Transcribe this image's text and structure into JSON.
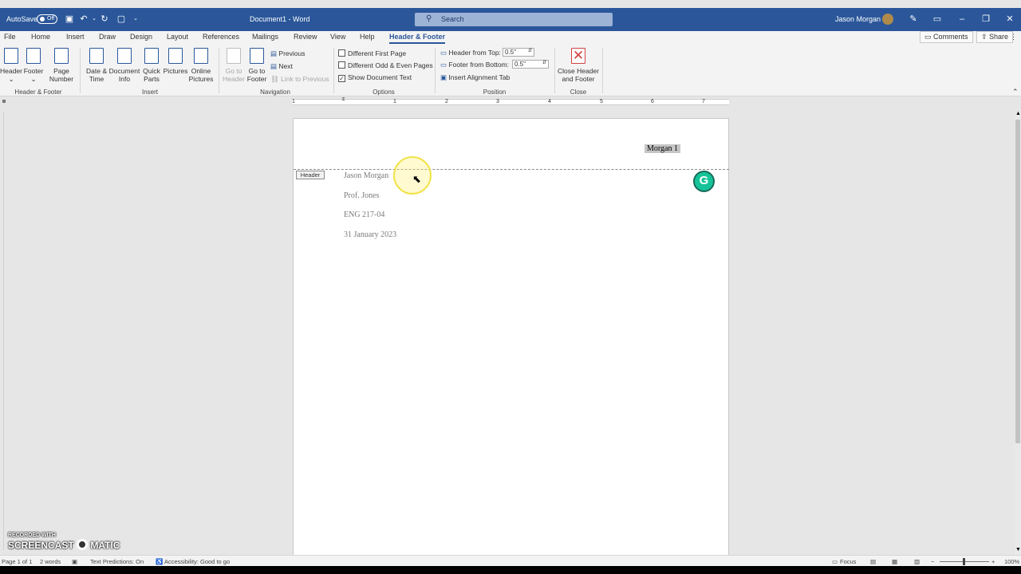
{
  "titlebar": {
    "autosave": "AutoSave",
    "autosave_state": "Off",
    "doc_title": "Document1 - Word",
    "search_placeholder": "Search",
    "user": "Jason Morgan"
  },
  "menu": [
    "File",
    "Home",
    "Insert",
    "Draw",
    "Design",
    "Layout",
    "References",
    "Mailings",
    "Review",
    "View",
    "Help",
    "Header & Footer"
  ],
  "menu_actions": {
    "comments": "Comments",
    "share": "Share"
  },
  "ribbon": {
    "header_footer": {
      "header": "Header",
      "footer": "Footer",
      "page": "Page",
      "number": "Number",
      "group": "Header & Footer"
    },
    "insert": {
      "date": "Date &",
      "time": "Time",
      "document": "Document",
      "info": "Info",
      "quick": "Quick",
      "parts": "Parts",
      "pictures": "Pictures",
      "online": "Online",
      "online2": "Pictures",
      "group": "Insert"
    },
    "navigation": {
      "goto_header1": "Go to",
      "goto_header2": "Header",
      "goto_footer1": "Go to",
      "goto_footer2": "Footer",
      "previous": "Previous",
      "next": "Next",
      "link": "Link to Previous",
      "group": "Navigation"
    },
    "options": {
      "diff_first": "Different First Page",
      "diff_odd": "Different Odd & Even Pages",
      "show_doc": "Show Document Text",
      "group": "Options"
    },
    "position": {
      "header_top": "Header from Top:",
      "header_top_val": "0.5\"",
      "footer_bottom": "Footer from Bottom:",
      "footer_bottom_val": "0.5\"",
      "align_tab": "Insert Alignment Tab",
      "group": "Position"
    },
    "close": {
      "label1": "Close Header",
      "label2": "and Footer",
      "group": "Close"
    }
  },
  "ruler": {
    "numbers": [
      "1",
      "1",
      "2",
      "3",
      "4",
      "5",
      "6",
      "7"
    ]
  },
  "document": {
    "header_tag": "Header",
    "header_text": "Morgan 1",
    "lines": [
      "Jason Morgan",
      "Prof. Jones",
      "ENG 217-04",
      "31 January 2023"
    ]
  },
  "grammarly": "G",
  "watermark": {
    "line1": "RECORDED WITH",
    "line2": "SCREENCAST",
    "line3": "MATIC"
  },
  "statusbar": {
    "page": "Page 1 of 1",
    "words": "2 words",
    "predictions": "Text Predictions: On",
    "accessibility": "Accessibility: Good to go",
    "focus": "Focus",
    "zoom": "100%"
  }
}
